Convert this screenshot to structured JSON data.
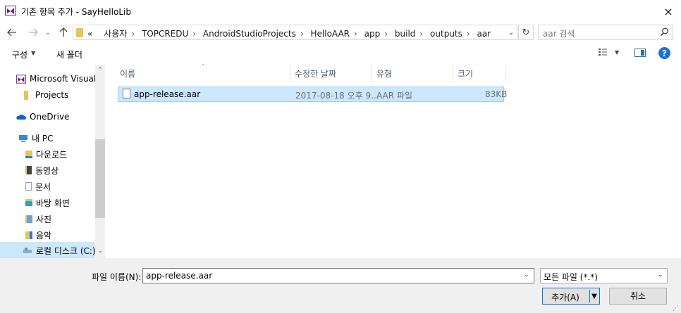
{
  "window": {
    "title": "기존 항목 추가 - SayHelloLib",
    "close_icon": "×"
  },
  "nav": {
    "breadcrumbs": [
      "«",
      "사용자",
      "TOPCREDU",
      "AndroidStudioProjects",
      "HelloAAR",
      "app",
      "build",
      "outputs",
      "aar"
    ],
    "search_placeholder": "aar 검색"
  },
  "toolbar": {
    "organize": "구성",
    "new_folder": "새 폴더"
  },
  "sidebar": {
    "items": [
      {
        "label": "Microsoft Visual S",
        "icon": "visual-studio-icon",
        "color": "#68217a"
      },
      {
        "label": "Projects",
        "icon": "folder-icon",
        "color": "#e8c25a"
      },
      {
        "label": "OneDrive",
        "icon": "cloud-icon",
        "color": "#0a64c8"
      },
      {
        "label": "내 PC",
        "icon": "pc-icon",
        "color": "#3a8ad8"
      },
      {
        "label": "다운로드",
        "icon": "downloads-icon",
        "color": "#2b7bd6"
      },
      {
        "label": "동영상",
        "icon": "videos-icon",
        "color": "#444444"
      },
      {
        "label": "문서",
        "icon": "documents-icon",
        "color": "#8aa4c8"
      },
      {
        "label": "바탕 화면",
        "icon": "desktop-icon",
        "color": "#2b9be0"
      },
      {
        "label": "사진",
        "icon": "pictures-icon",
        "color": "#6aa3d8"
      },
      {
        "label": "음악",
        "icon": "music-icon",
        "color": "#2b7bd6"
      },
      {
        "label": "로컬 디스크 (C:)",
        "icon": "drive-icon",
        "color": "#5a8fc4"
      }
    ]
  },
  "filelist": {
    "columns": [
      "이름",
      "수정한 날짜",
      "유형",
      "크기"
    ],
    "rows": [
      {
        "name": "app-release.aar",
        "date": "2017-08-18 오후 9...",
        "type": "AAR 파일",
        "size": "83KB"
      }
    ]
  },
  "footer": {
    "filename_label": "파일 이름(N):",
    "filename_value": "app-release.aar",
    "filter_value": "모든 파일 (*.*)",
    "add_label": "추가(A)",
    "cancel_label": "취소"
  },
  "colors": {
    "selection": "#cce8ff",
    "accent": "#0078d7"
  }
}
